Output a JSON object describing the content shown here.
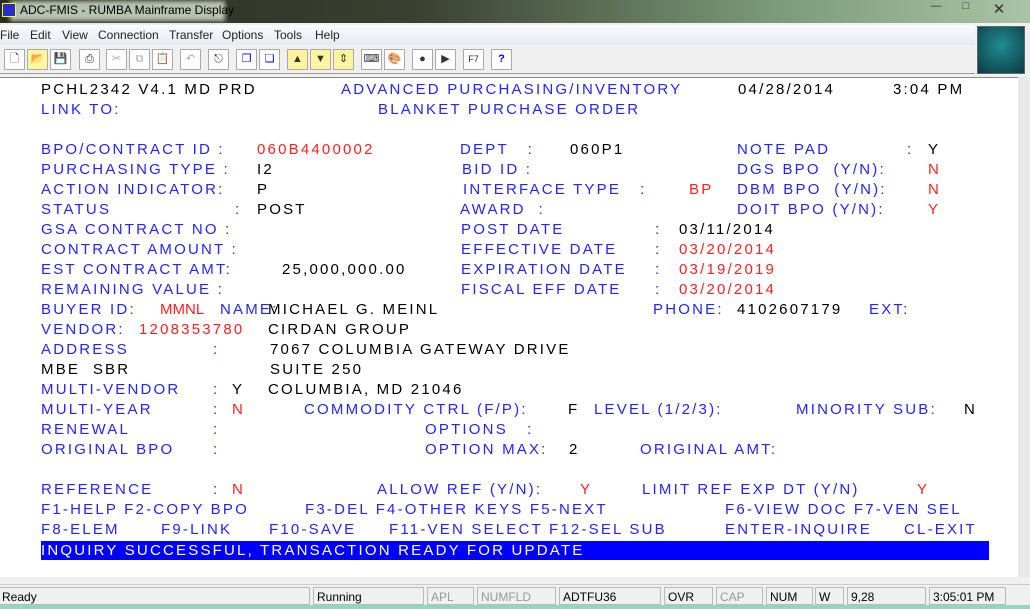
{
  "window": {
    "title": "ADC-FMIS - RUMBA Mainframe Display",
    "controls": [
      "minimize",
      "maximize",
      "close"
    ]
  },
  "menu": [
    "File",
    "Edit",
    "View",
    "Connection",
    "Transfer",
    "Options",
    "Tools",
    "Help"
  ],
  "toolbar": [
    "new-icon",
    "open-icon",
    "save-icon",
    "print-icon",
    "cut-icon",
    "copy-icon",
    "paste-icon",
    "undo-icon",
    "connect-icon",
    "window-icon",
    "window2-icon",
    "send-file-icon",
    "receive-file-icon",
    "transfer-list-icon",
    "keyboard-icon",
    "palette-icon",
    "record-macro-icon",
    "play-macro-icon",
    "F7",
    "help-pointer-icon"
  ],
  "screen": {
    "header": {
      "program": "PCHL2342 V4.1 MD PRD",
      "system": "ADVANCED PURCHASING/INVENTORY",
      "date": "04/28/2014",
      "time": "3:04 PM",
      "link_label": "LINK TO:",
      "title": "BLANKET PURCHASE ORDER"
    },
    "bpo_id": {
      "label": "BPO/CONTRACT ID :",
      "value": "060B4400002"
    },
    "purch_type": {
      "label": "PURCHASING TYPE :",
      "value": "I2"
    },
    "action": {
      "label": "ACTION INDICATOR:",
      "value": "P"
    },
    "status": {
      "label": "STATUS",
      "colon": ":",
      "value": "POST"
    },
    "gsa": {
      "label": "GSA CONTRACT NO :"
    },
    "contract_amount": {
      "label": "CONTRACT AMOUNT :"
    },
    "est_amt": {
      "label": "EST CONTRACT AMT:",
      "value": "25,000,000.00"
    },
    "remaining": {
      "label": "REMAINING VALUE :"
    },
    "dept": {
      "label": "DEPT   :",
      "value": "060P1"
    },
    "bid_id": {
      "label": "BID ID :"
    },
    "interface": {
      "label": "INTERFACE TYPE   :",
      "value": "BP"
    },
    "award": {
      "label": "AWARD  :"
    },
    "post_date": {
      "label": "POST DATE",
      "colon": ":",
      "value": "03/11/2014"
    },
    "effective_date": {
      "label": "EFFECTIVE DATE",
      "colon": ":",
      "value": "03/20/2014"
    },
    "expiration_date": {
      "label": "EXPIRATION DATE",
      "colon": ":",
      "value": "03/19/2019"
    },
    "fiscal_date": {
      "label": "FISCAL EFF DATE",
      "colon": ":",
      "value": "03/20/2014"
    },
    "note_pad": {
      "label": "NOTE PAD",
      "colon": ":",
      "value": "Y"
    },
    "dgs": {
      "label": "DGS BPO  (Y/N):",
      "value": "N"
    },
    "dbm": {
      "label": "DBM BPO  (Y/N):",
      "value": "N"
    },
    "doit": {
      "label": "DOIT BPO (Y/N):",
      "value": "Y"
    },
    "buyer": {
      "label": "BUYER ID:",
      "value": "MMNL",
      "name_label": "NAME:",
      "name": "MICHAEL G. MEINL",
      "phone_label": "PHONE:",
      "phone": "4102607179",
      "ext_label": "EXT:"
    },
    "vendor": {
      "label": "VENDOR:",
      "value": "1208353780",
      "name": "CIRDAN GROUP"
    },
    "address": {
      "label": "ADDRESS",
      "colon": ":",
      "line1": "7067 COLUMBIA GATEWAY DRIVE",
      "line2": "SUITE 250",
      "line3": "COLUMBIA, MD 21046"
    },
    "mbe": "MBE  SBR",
    "multi_vendor": {
      "label": "MULTI-VENDOR",
      "colon": ":",
      "value": "Y"
    },
    "multi_year": {
      "label": "MULTI-YEAR",
      "colon": ":",
      "value": "N"
    },
    "commodity": {
      "label": "COMMODITY CTRL (F/P):",
      "value": "F"
    },
    "level": {
      "label": "LEVEL (1/2/3):"
    },
    "minority": {
      "label": "MINORITY SUB:",
      "value": "N"
    },
    "renewal": {
      "label": "RENEWAL",
      "colon": ":"
    },
    "options": {
      "label": "OPTIONS   :"
    },
    "original_bpo": {
      "label": "ORIGINAL BPO",
      "colon": ":"
    },
    "option_max": {
      "label": "OPTION MAX:",
      "value": "2"
    },
    "original_amt": {
      "label": "ORIGINAL AMT:"
    },
    "reference": {
      "label": "REFERENCE",
      "colon": ":",
      "value": "N"
    },
    "allow_ref": {
      "label": "ALLOW REF (Y/N):",
      "value": "Y"
    },
    "limit_ref": {
      "label": "LIMIT REF EXP DT (Y/N)",
      "value": "Y"
    },
    "fkeys1": [
      "F1-HELP F2-COPY BPO",
      "F3-DEL F4-OTHER KEYS F5-NEXT",
      "F6-VIEW DOC F7-VEN SEL"
    ],
    "fkeys2": [
      "F8-ELEM",
      "F9-LINK",
      "F10-SAVE",
      "F11-VEN SELECT F12-SEL SUB",
      "ENTER-INQUIRE",
      "CL-EXIT"
    ],
    "message": "INQUIRY SUCCESSFUL, TRANSACTION READY FOR UPDATE"
  },
  "statusbar": {
    "state": "Ready",
    "session": "Running",
    "apl": "APL",
    "numfld": "NUMFLD",
    "lu": "ADTFU36",
    "ovr": "OVR",
    "cap": "CAP",
    "num": "NUM",
    "w": "W",
    "cursor": "9,28",
    "clock": "3:05:01 PM"
  },
  "colors": {
    "label": "#2424ff",
    "protected_value": "#000000",
    "highlight": "#ff2020",
    "message_bar": "#0000ff"
  }
}
